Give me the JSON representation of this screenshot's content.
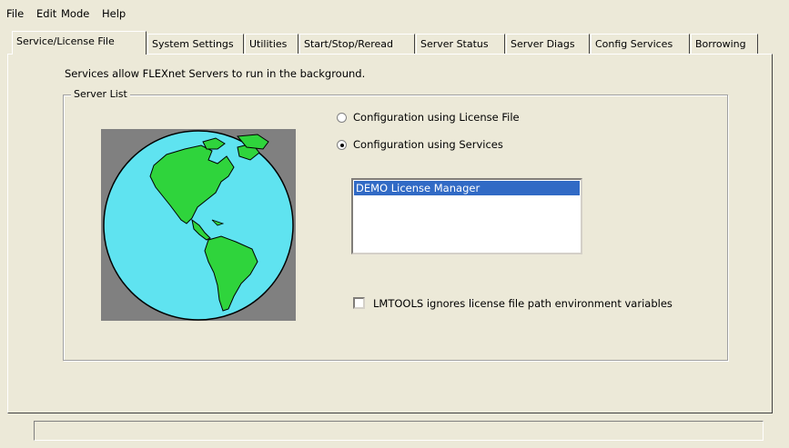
{
  "menu": {
    "items": [
      {
        "label": "File"
      },
      {
        "label": "Edit"
      },
      {
        "label": "Mode"
      },
      {
        "label": "Help"
      }
    ]
  },
  "tabs": [
    {
      "label": "Service/License File",
      "active": true
    },
    {
      "label": "System Settings"
    },
    {
      "label": "Utilities"
    },
    {
      "label": "Start/Stop/Reread"
    },
    {
      "label": "Server Status"
    },
    {
      "label": "Server Diags"
    },
    {
      "label": "Config Services"
    },
    {
      "label": "Borrowing"
    }
  ],
  "panel": {
    "intro_text": "Services allow FLEXnet Servers to run in the background.",
    "group_title": "Server List",
    "radio_license_file": "Configuration using License File",
    "radio_services": "Configuration using Services",
    "selected_radio": "services",
    "services_list": [
      "DEMO License Manager"
    ],
    "selected_service": "DEMO License Manager",
    "checkbox_label": "LMTOOLS ignores license file path environment variables",
    "checkbox_checked": false
  },
  "icons": {
    "globe": "globe-icon"
  },
  "colors": {
    "background": "#ece9d8",
    "selection": "#316ac5",
    "ocean": "#5fe3f0",
    "land": "#2fd43c",
    "globe_frame": "#808080"
  }
}
